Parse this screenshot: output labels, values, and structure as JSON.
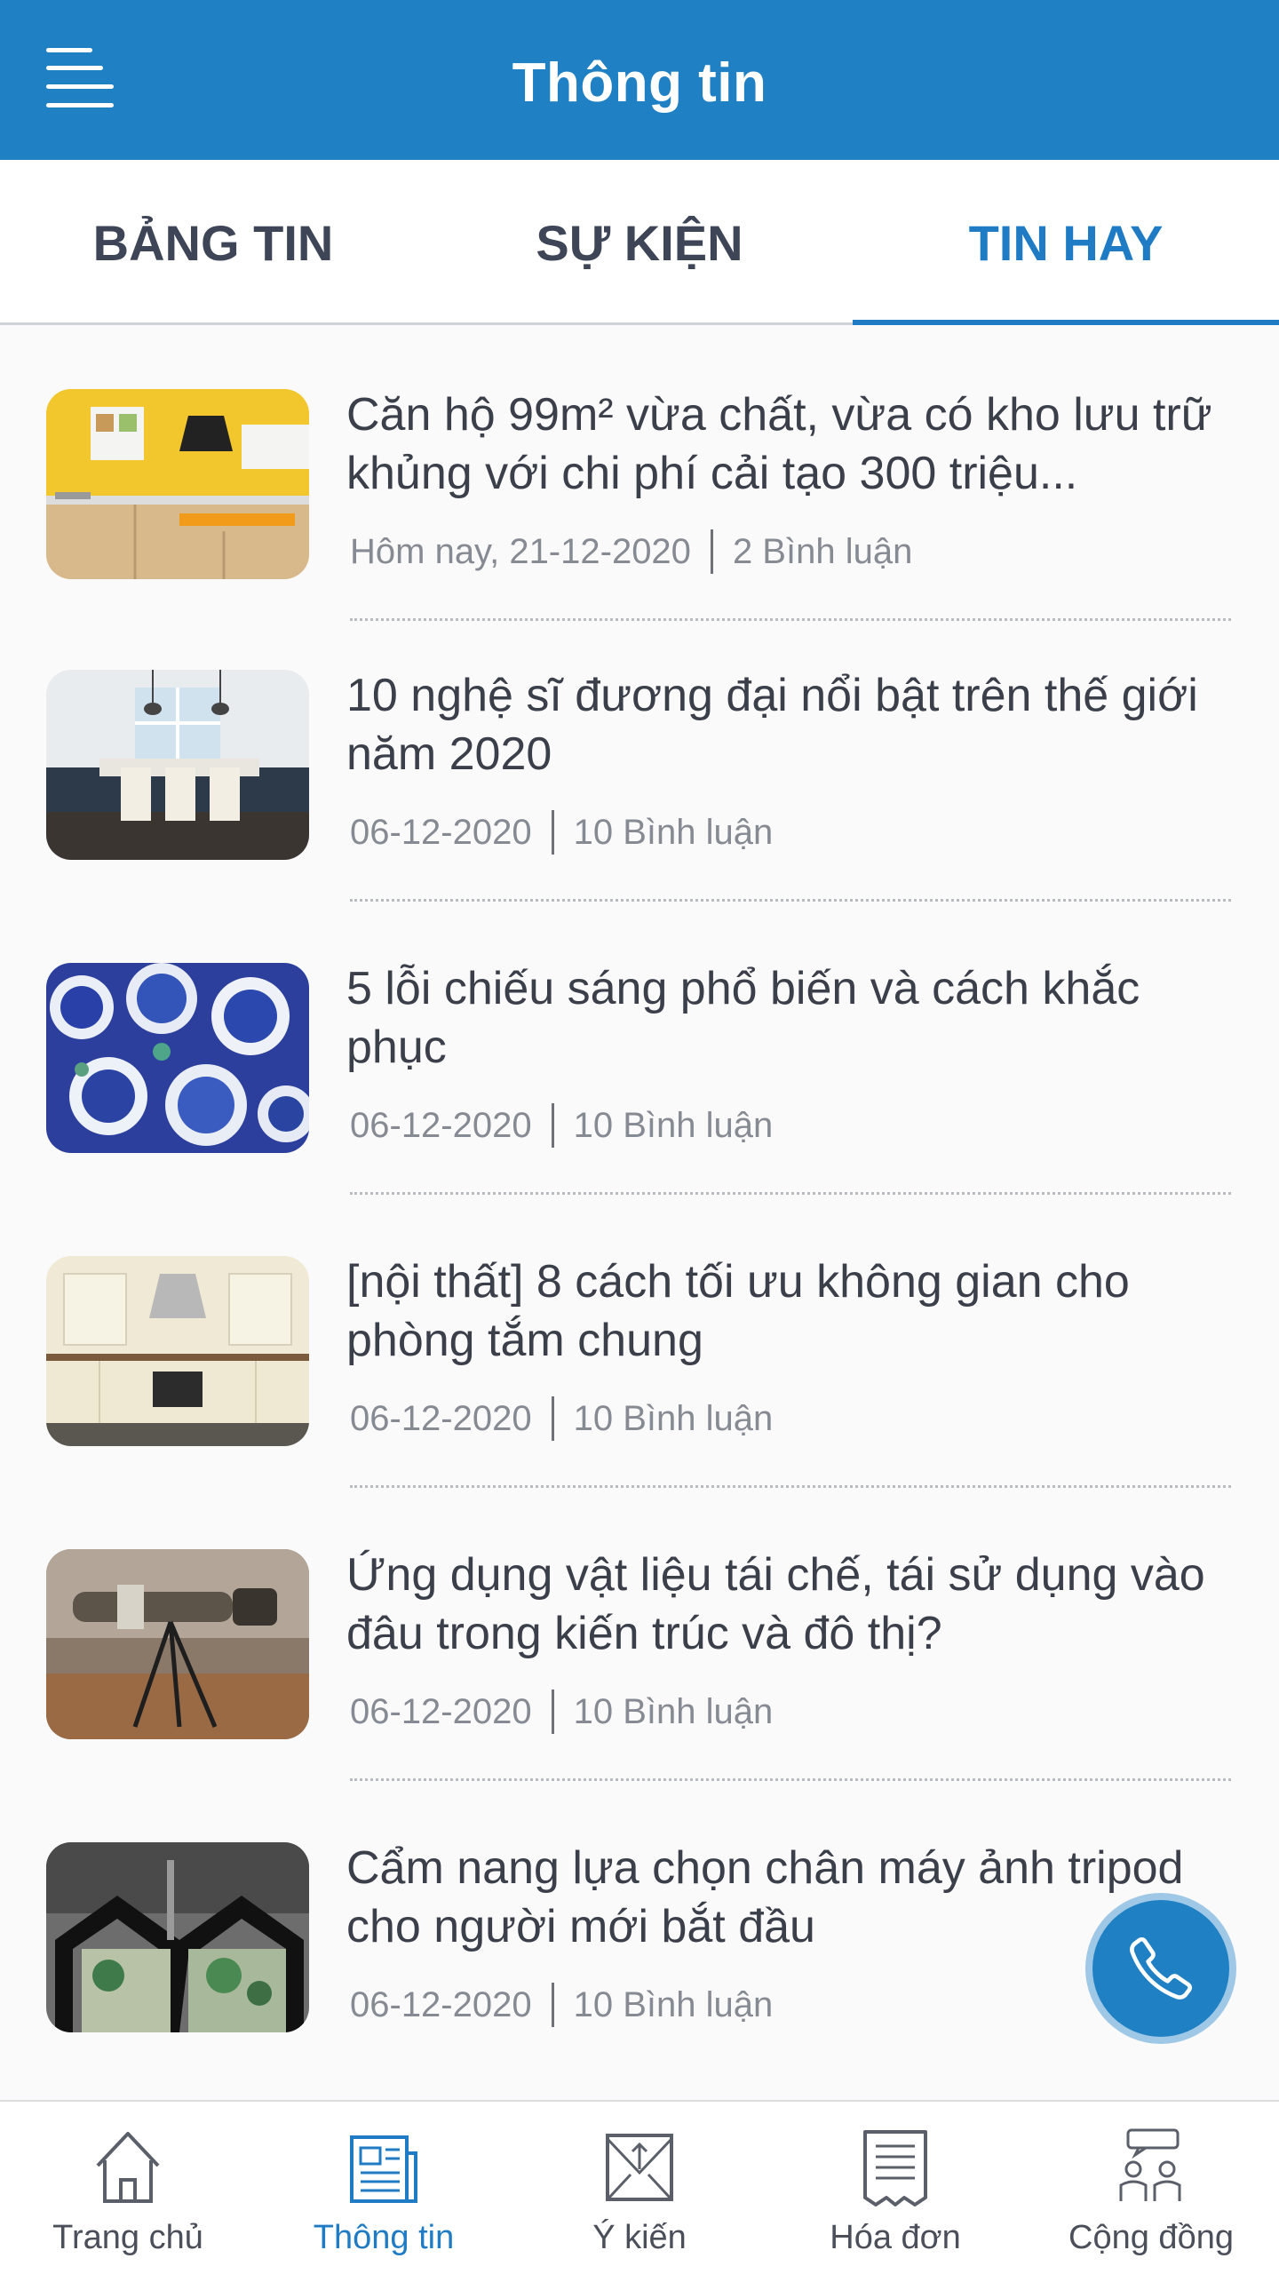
{
  "header": {
    "title": "Thông tin",
    "menu_icon": "hamburger-menu-icon",
    "background": "#1f80c4"
  },
  "tabs": [
    {
      "label": "BẢNG TIN",
      "active": false
    },
    {
      "label": "SỰ KIỆN",
      "active": false
    },
    {
      "label": "TIN HAY",
      "active": true
    }
  ],
  "accent_color": "#1f7cc4",
  "articles": [
    {
      "title": "Căn hộ 99m² vừa chất, vừa có kho lưu trữ khủng với chi phí cải tạo 300 triệu...",
      "date": "Hôm nay, 21-12-2020",
      "comments": "2 Bình luận",
      "thumbnail": "yellow-kitchen"
    },
    {
      "title": "10 nghệ sĩ đương đại nổi bật trên thế giới năm 2020",
      "date": "06-12-2020",
      "comments": "10 Bình luận",
      "thumbnail": "dining-kitchen"
    },
    {
      "title": "5 lỗi chiếu sáng phổ biến và cách khắc phục",
      "date": "06-12-2020",
      "comments": "10 Bình luận",
      "thumbnail": "blue-ceramics"
    },
    {
      "title": "[nội thất] 8 cách tối ưu không gian cho phòng tắm chung",
      "date": "06-12-2020",
      "comments": "10 Bình luận",
      "thumbnail": "cream-kitchen"
    },
    {
      "title": "Ứng dụng vật liệu tái chế, tái sử dụng vào đâu trong kiến trúc và đô thị?",
      "date": "06-12-2020",
      "comments": "10 Bình luận",
      "thumbnail": "camera-tripod"
    },
    {
      "title": "Cẩm nang lựa chọn chân máy ảnh tripod cho người mới bắt đầu",
      "date": "06-12-2020",
      "comments": "10 Bình luận",
      "thumbnail": "house-artwork"
    }
  ],
  "call_button": {
    "icon": "phone-icon"
  },
  "bottom_nav": [
    {
      "label": "Trang chủ",
      "icon": "home-icon",
      "active": false
    },
    {
      "label": "Thông tin",
      "icon": "newspaper-icon",
      "active": true
    },
    {
      "label": "Ý kiến",
      "icon": "feedback-envelope-icon",
      "active": false
    },
    {
      "label": "Hóa đơn",
      "icon": "invoice-icon",
      "active": false
    },
    {
      "label": "Cộng đồng",
      "icon": "community-icon",
      "active": false
    }
  ]
}
